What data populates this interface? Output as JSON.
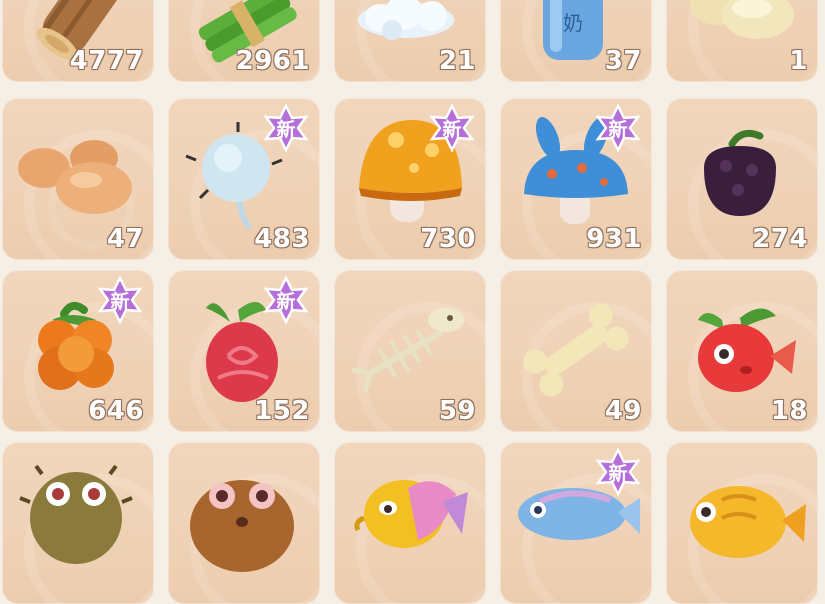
{
  "inventory": {
    "new_label": "新",
    "rows": [
      [
        {
          "name": "wood-log",
          "count": "4777",
          "is_new": false
        },
        {
          "name": "green-bamboo-bundle",
          "count": "2961",
          "is_new": false
        },
        {
          "name": "cotton-cloud",
          "count": "21",
          "is_new": false
        },
        {
          "name": "milk-bottle",
          "count": "37",
          "is_new": false
        },
        {
          "name": "potatoes",
          "count": "1",
          "is_new": false
        }
      ],
      [
        {
          "name": "eggs",
          "count": "47",
          "is_new": false
        },
        {
          "name": "dandelion-puff",
          "count": "483",
          "is_new": true
        },
        {
          "name": "orange-mushroom",
          "count": "730",
          "is_new": true
        },
        {
          "name": "blue-rabbit-mushroom",
          "count": "931",
          "is_new": true
        },
        {
          "name": "black-berry",
          "count": "274",
          "is_new": false
        }
      ],
      [
        {
          "name": "orange-cloudberry",
          "count": "646",
          "is_new": true
        },
        {
          "name": "red-swirl-fruit",
          "count": "152",
          "is_new": true
        },
        {
          "name": "fish-bone",
          "count": "59",
          "is_new": false
        },
        {
          "name": "bone",
          "count": "49",
          "is_new": false
        },
        {
          "name": "red-apple-fish",
          "count": "18",
          "is_new": false
        }
      ],
      [
        {
          "name": "pufferfish",
          "count": "",
          "is_new": false
        },
        {
          "name": "brown-toad-fish",
          "count": "",
          "is_new": false
        },
        {
          "name": "yellow-pink-seahorse-fish",
          "count": "",
          "is_new": false
        },
        {
          "name": "blue-arowana-fish",
          "count": "",
          "is_new": true
        },
        {
          "name": "golden-fish",
          "count": "",
          "is_new": false
        }
      ]
    ]
  },
  "colors": {
    "slot_bg": "#efd2b6",
    "page_bg": "#f6efe6",
    "badge_purple": "#b56fd8",
    "count_text": "#ffffff"
  }
}
